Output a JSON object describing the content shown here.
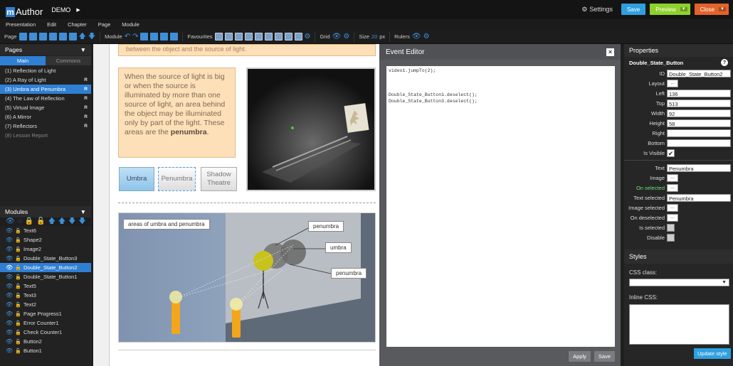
{
  "topbar": {
    "logo_m": "m",
    "logo_text": "Author",
    "project": "DEMO",
    "settings_label": "Settings",
    "save_label": "Save",
    "preview_label": "Preview",
    "close_label": "Close"
  },
  "menu": [
    "Presentation",
    "Edit",
    "Chapter",
    "Page",
    "Module"
  ],
  "toolbar": {
    "page_label": "Page",
    "module_label": "Module",
    "favourites_label": "Favourites",
    "grid_label": "Grid",
    "size_label": "Size",
    "size_value": "20",
    "size_unit": "px",
    "rulers_label": "Rulers"
  },
  "pages": {
    "title": "Pages",
    "tab_main": "Main",
    "tab_commons": "Commons",
    "items": [
      {
        "label": "(1) Reflection of Light",
        "r": ""
      },
      {
        "label": "(2) A Ray of Light",
        "r": "R"
      },
      {
        "label": "(3) Umbra and Penumbra",
        "r": "R"
      },
      {
        "label": "(4) The Law of Reflection",
        "r": "R"
      },
      {
        "label": "(5) Virtual Image",
        "r": "R"
      },
      {
        "label": "(6) A Mirror",
        "r": "R"
      },
      {
        "label": "(7) Reflectors",
        "r": "R"
      },
      {
        "label": "(8) Lesson Report",
        "r": ""
      }
    ]
  },
  "modules": {
    "title": "Modules",
    "items": [
      "Text6",
      "Shape2",
      "Image2",
      "Double_State_Button3",
      "Double_State_Button2",
      "Double_State_Button1",
      "Text5",
      "Text3",
      "Text2",
      "Page Progress1",
      "Error Counter1",
      "Check Counter1",
      "Button2",
      "Button1"
    ]
  },
  "canvas": {
    "top_text": "between the object and the source of light.",
    "main_text": "When the source of light is big or when the source is illuminated by more than one source of light, an area behind the object may be illuminated only by part of the light. These areas are the ",
    "main_bold": "penumbra",
    "main_end": ".",
    "btn_umbra": "Umbra",
    "btn_penumbra": "Penumbra",
    "btn_shadow": "Shadow Theatre",
    "caption": "areas of umbra and penumbra",
    "label1": "penumbra",
    "label2": "umbra",
    "label3": "penumbra"
  },
  "event_editor": {
    "title": "Event Editor",
    "close": "×",
    "code": "video1.jumpTo(2);\n\n\n\nDouble_State_Button1.deselect();\nDouble_State_Button3.deselect();",
    "apply_label": "Apply",
    "save_label": "Save"
  },
  "properties": {
    "title": "Properties",
    "module_name": "Double_State_Button",
    "id_label": "ID",
    "id_value": "Double_State_Button2",
    "layout_label": "Layout",
    "layout_btn": "...",
    "left_label": "Left",
    "left_value": "136",
    "top_label": "Top",
    "top_value": "513",
    "width_label": "Width",
    "width_value": "92",
    "height_label": "Height",
    "height_value": "58",
    "right_label": "Right",
    "right_value": "",
    "bottom_label": "Bottom",
    "bottom_value": "",
    "visible_label": "Is Visible",
    "visible_check": "✔",
    "text_label": "Text",
    "text_value": "Penumbra",
    "image_label": "Image",
    "image_btn": "...",
    "onselected_label": "On selected",
    "onselected_btn": "...",
    "textsel_label": "Text selected",
    "textsel_value": "Penumbra",
    "imgsel_label": "Image selected",
    "imgsel_btn": "...",
    "ondesel_label": "On deselected",
    "ondesel_btn": "...",
    "issel_label": "Is selected",
    "disable_label": "Disable"
  },
  "styles": {
    "title": "Styles",
    "css_class_label": "CSS class:",
    "inline_css_label": "Inline CSS:",
    "update_label": "Update style"
  },
  "colors": {
    "accent": "#2f7fd3",
    "save": "#2ea0e0",
    "preview": "#8ed12c",
    "close": "#e2632b"
  }
}
